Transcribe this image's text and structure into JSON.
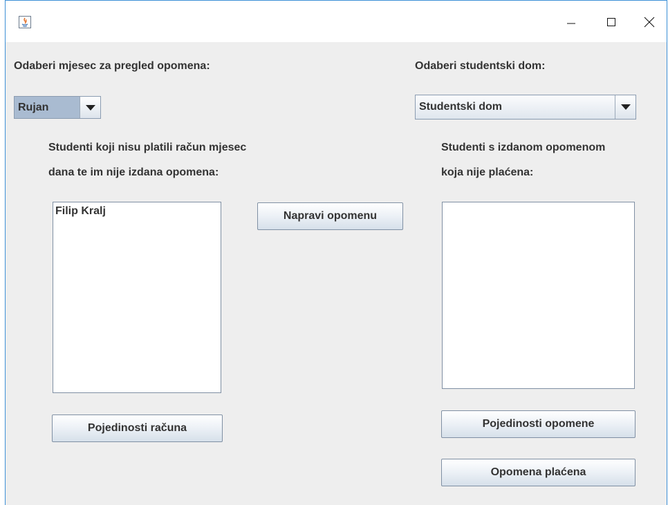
{
  "titlebar": {
    "app_icon": "java-icon",
    "minimize_icon": "minimize-icon",
    "maximize_icon": "maximize-icon",
    "close_icon": "close-icon"
  },
  "left": {
    "month_label": "Odaberi mjesec za pregled opomena:",
    "month_selected": "Rujan",
    "list_heading_line1": "Studenti koji nisu platili račun mjesec",
    "list_heading_line2": "dana te im nije izdana opomena:",
    "students": [
      "Filip Kralj"
    ],
    "details_button": "Pojedinosti računa"
  },
  "center": {
    "create_button": "Napravi opomenu"
  },
  "right": {
    "dorm_label": "Odaberi studentski dom:",
    "dorm_selected": "Studentski dom",
    "list_heading_line1": "Studenti s izdanom opomenom",
    "list_heading_line2": "koja nije plaćena:",
    "students": [],
    "details_button": "Pojedinosti opomene",
    "paid_button": "Opomena plaćena"
  },
  "colors": {
    "window_bg": "#eeeeee",
    "border_accent": "#3c8fd6",
    "selected_combo": "#a9bbd1"
  }
}
